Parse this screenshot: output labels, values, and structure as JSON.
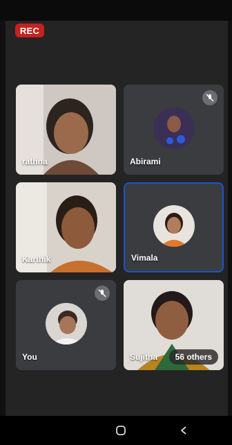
{
  "recording": {
    "label": "REC",
    "color": "#c5221f"
  },
  "tiles": [
    {
      "name": "rathna",
      "type": "video",
      "muted": false
    },
    {
      "name": "Abirami",
      "type": "avatar",
      "muted": true
    },
    {
      "name": "Karthik",
      "type": "video",
      "muted": false
    },
    {
      "name": "Vimala",
      "type": "avatar",
      "muted": false,
      "active_speaker": true
    },
    {
      "name": "You",
      "type": "avatar",
      "muted": true
    },
    {
      "name": "Sujitha",
      "type": "video",
      "muted": false,
      "others_label": "56 others"
    }
  ],
  "nav": {
    "home_icon": "circle-home-icon",
    "back_icon": "chevron-back-icon"
  },
  "colors": {
    "tile_bg": "#3a3c40",
    "active_border": "#1a56c8"
  }
}
